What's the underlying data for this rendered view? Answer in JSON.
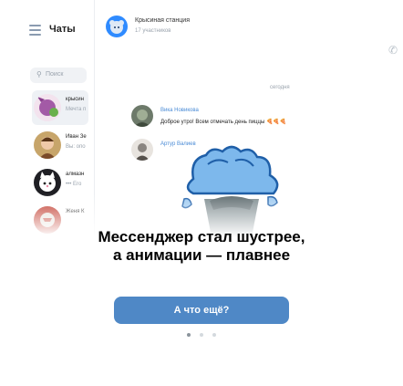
{
  "app_screenshot": {
    "sidebar_title": "Чаты",
    "search_placeholder": "Поиск",
    "channel": {
      "name": "Крысиная станция",
      "members": "17 участников"
    },
    "chats": [
      {
        "name": "крысин",
        "preview": "Мечта п"
      },
      {
        "name": "Иван Зе",
        "preview": "Вы: опо"
      },
      {
        "name": "алмазн",
        "preview": "••• Его"
      },
      {
        "name": "Женя К"
      }
    ],
    "date_label": "сегодня",
    "messages": [
      {
        "author": "Вика Новикова",
        "text": "Доброе утро! Всем отмечать день пиццы 🍕🍕🍕"
      },
      {
        "author": "Артур Валиев",
        "text": ""
      }
    ]
  },
  "headline_line1": "Мессенджер стал шустрее,",
  "headline_line2": "а анимации — плавнее",
  "cta_label": "А что ещё?",
  "pager": {
    "total": 3,
    "active": 0
  },
  "colors": {
    "accent": "#4f88c6",
    "link": "#4a8bd6",
    "channel_avatar": "#2f8bff",
    "dot_active": "#8b949c",
    "dot_inactive": "#d4d9de"
  }
}
